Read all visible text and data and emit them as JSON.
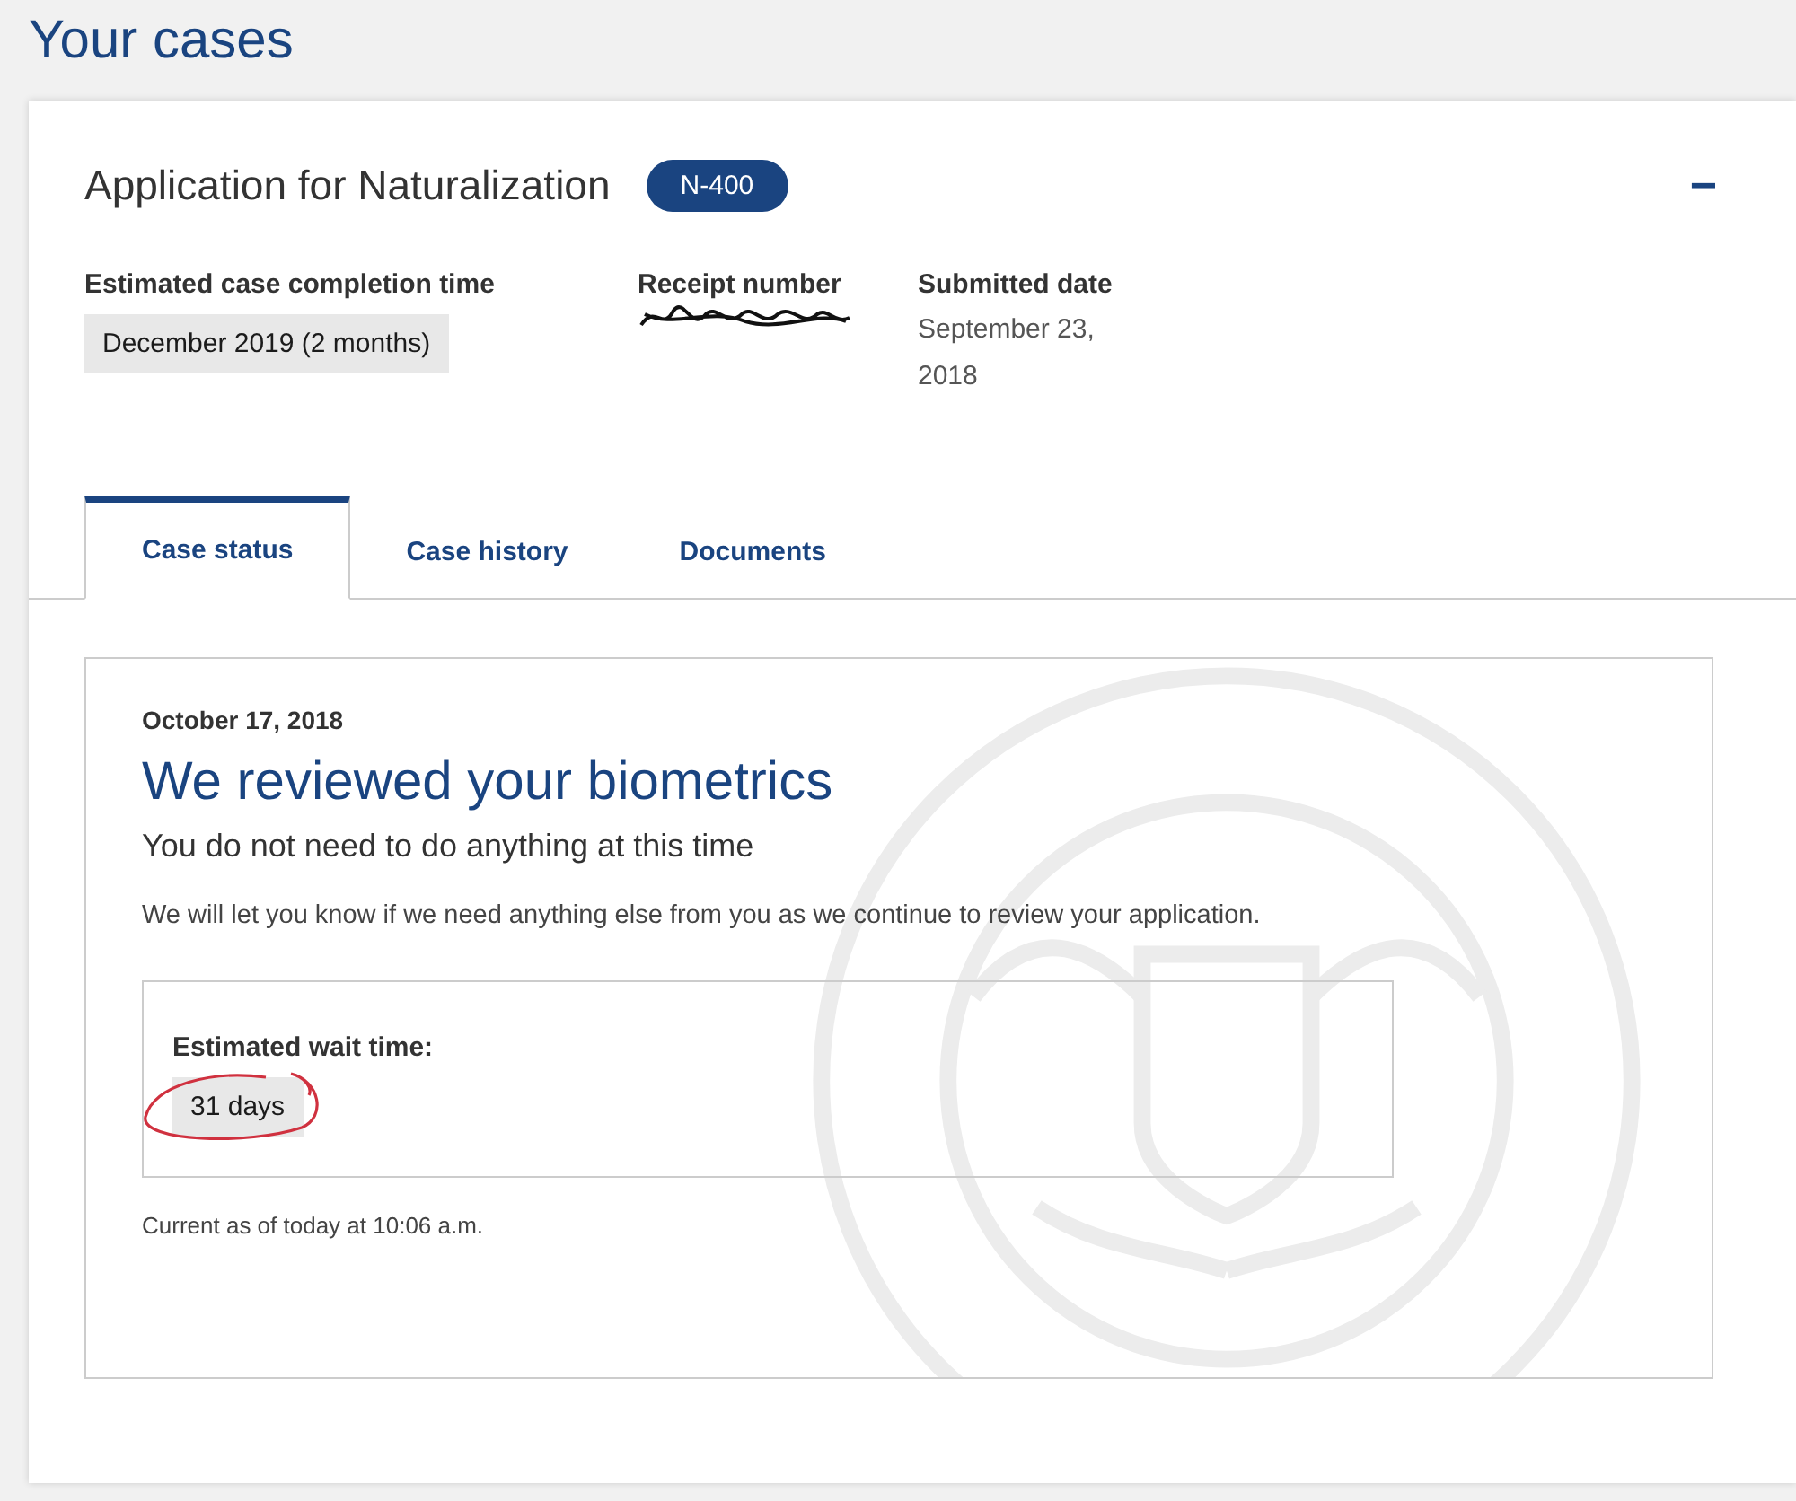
{
  "page_title": "Your cases",
  "case": {
    "title": "Application for Naturalization",
    "form_badge": "N-400",
    "collapse_symbol": "−",
    "fields": [
      {
        "kind": "chip",
        "label": "Estimated case completion time",
        "value": "December 2019 (2 months)"
      },
      {
        "kind": "redacted",
        "label": "Receipt number"
      },
      {
        "kind": "text",
        "label": "Submitted date",
        "value": "September 23, 2018"
      }
    ]
  },
  "tabs": [
    {
      "label": "Case status",
      "selected": true
    },
    {
      "label": "Case history",
      "selected": false
    },
    {
      "label": "Documents",
      "selected": false
    }
  ],
  "status": {
    "date": "October 17, 2018",
    "heading": "We reviewed your biometrics",
    "subheading": "You do not need to do anything at this time",
    "message": "We will let you know if we need anything else from you as we continue to review your application.",
    "wait": {
      "label": "Estimated wait time:",
      "value": "31 days",
      "circled": true
    },
    "updated": "Current as of today at 10:06 a.m."
  }
}
